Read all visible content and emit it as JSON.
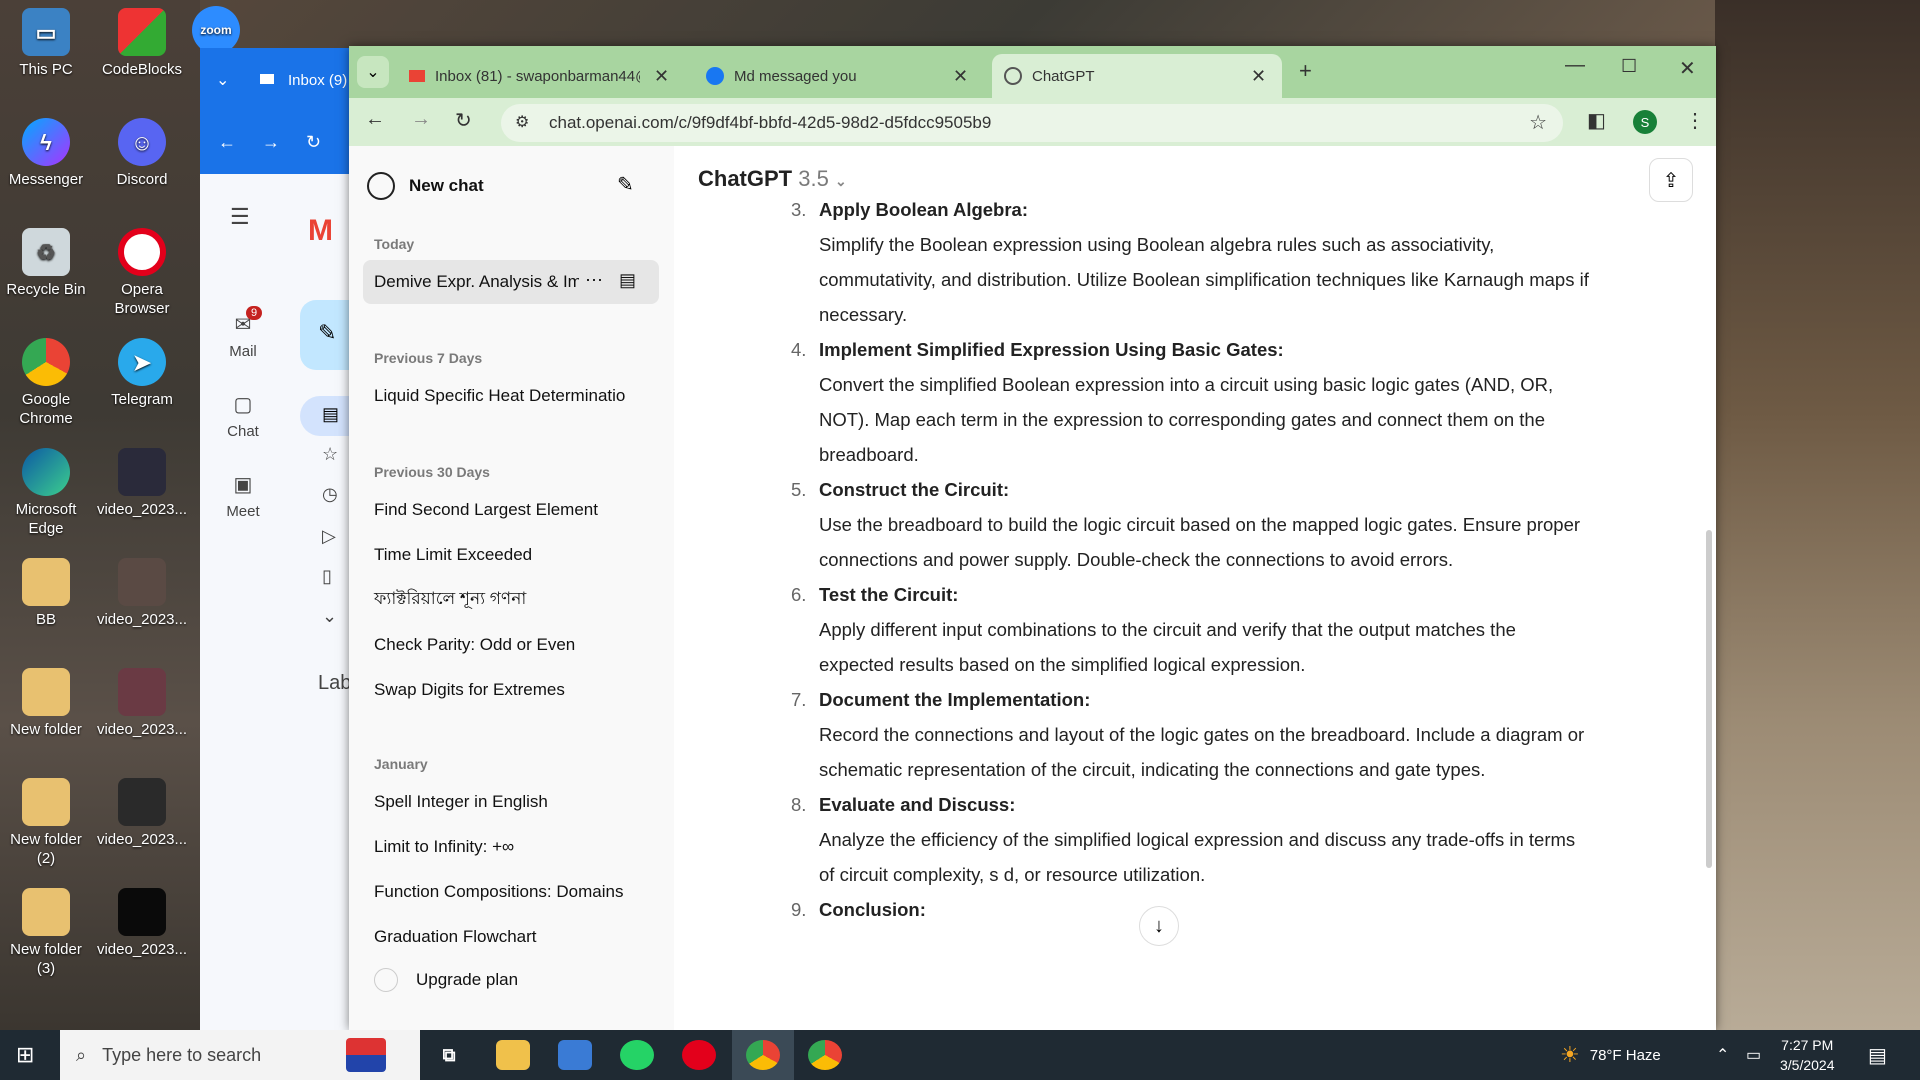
{
  "desktop": {
    "icons": [
      {
        "label": "This PC"
      },
      {
        "label": "CodeBlocks"
      },
      {
        "label": "zoom"
      },
      {
        "label": "Messenger"
      },
      {
        "label": "Discord"
      },
      {
        "label": "Recycle Bin"
      },
      {
        "label": "Opera Browser"
      },
      {
        "label": "Google Chrome"
      },
      {
        "label": "Telegram"
      },
      {
        "label": "Microsoft Edge"
      },
      {
        "label": "video_2023..."
      },
      {
        "label": "BB"
      },
      {
        "label": "video_2023..."
      },
      {
        "label": "New folder"
      },
      {
        "label": "video_2023..."
      },
      {
        "label": "New folder (2)"
      },
      {
        "label": "video_2023..."
      },
      {
        "label": "New folder (3)"
      },
      {
        "label": "video_2023..."
      }
    ]
  },
  "gmail": {
    "tab_label": "Inbox (9)",
    "rail": [
      {
        "label": "Mail",
        "badge": "9"
      },
      {
        "label": "Chat"
      },
      {
        "label": "Meet"
      }
    ],
    "label_text": "Lab"
  },
  "chrome": {
    "tabs": [
      {
        "label": "Inbox (81) - swaponbarman44@"
      },
      {
        "label": "Md messaged you"
      },
      {
        "label": "ChatGPT"
      }
    ],
    "url": "chat.openai.com/c/9f9df4bf-bbfd-42d5-98d2-d5fdcc9505b9",
    "profile_initial": "S"
  },
  "sidebar": {
    "new_chat": "New chat",
    "sections": [
      {
        "title": "Today",
        "items": [
          "Demive Expr. Analysis & Im"
        ]
      },
      {
        "title": "Previous 7 Days",
        "items": [
          "Liquid Specific Heat Determinatio"
        ]
      },
      {
        "title": "Previous 30 Days",
        "items": [
          "Find Second Largest Element",
          "Time Limit Exceeded",
          "ফ্যাক্টরিয়ালে শূন্য গণনা",
          "Check Parity: Odd or Even",
          "Swap Digits for Extremes"
        ]
      },
      {
        "title": "January",
        "items": [
          "Spell Integer in English",
          "Limit to Infinity: +∞",
          "Function Compositions: Domains",
          "Graduation Flowchart"
        ]
      }
    ],
    "upgrade": "Upgrade plan"
  },
  "main": {
    "model": "ChatGPT",
    "version": "3.5",
    "steps": [
      {
        "num": "3.",
        "title": "Apply Boolean Algebra:",
        "body": "Simplify the Boolean expression using Boolean algebra rules such as associativity, commutativity, and distribution. Utilize Boolean simplification techniques like Karnaugh maps if necessary."
      },
      {
        "num": "4.",
        "title": "Implement Simplified Expression Using Basic Gates:",
        "body": "Convert the simplified Boolean expression into a circuit using basic logic gates (AND, OR, NOT). Map each term in the expression to corresponding gates and connect them on the breadboard."
      },
      {
        "num": "5.",
        "title": "Construct the Circuit:",
        "body": "Use the breadboard to build the logic circuit based on the mapped logic gates. Ensure proper connections and power supply. Double-check the connections to avoid errors."
      },
      {
        "num": "6.",
        "title": "Test the Circuit:",
        "body": "Apply different input combinations to the circuit and verify that the output matches the expected results based on the simplified logical expression."
      },
      {
        "num": "7.",
        "title": "Document the Implementation:",
        "body": "Record the connections and layout of the logic gates on the breadboard. Include a diagram or schematic representation of the circuit, indicating the connections and gate types."
      },
      {
        "num": "8.",
        "title": "Evaluate and Discuss:",
        "body": "Analyze the efficiency of the simplified logical expression and discuss any trade-offs in terms of circuit complexity, s  d, or resource utilization."
      },
      {
        "num": "9.",
        "title": "Conclusion:",
        "body": ""
      }
    ]
  },
  "taskbar": {
    "search_placeholder": "Type here to search",
    "weather": "78°F  Haze",
    "time": "7:27 PM",
    "date": "3/5/2024"
  }
}
